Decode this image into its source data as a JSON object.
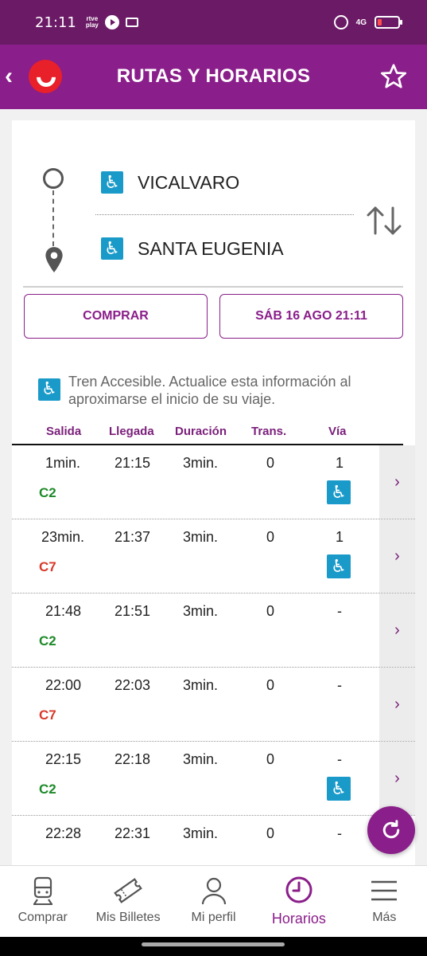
{
  "status_bar": {
    "time": "21:11",
    "rtve_label": "rtve\nplay",
    "network": "4G"
  },
  "app_bar": {
    "title": "RUTAS Y HORARIOS",
    "back_icon": "chevron-left-icon",
    "favorite_icon": "star-outline-icon"
  },
  "route": {
    "origin": "VICALVARO",
    "destination": "SANTA EUGENIA"
  },
  "actions": {
    "buy_label": "COMPRAR",
    "date_label": "SÁB 16 AGO 21:11"
  },
  "notice": "Tren Accesible. Actualice esta información al aproximarse el inicio de su viaje.",
  "table": {
    "headers": [
      "Salida",
      "Llegada",
      "Duración",
      "Trans.",
      "Vía"
    ],
    "rows": [
      {
        "salida": "1min.",
        "llegada": "21:15",
        "duracion": "3min.",
        "trans": "0",
        "via": "1",
        "line": "C2",
        "line_color": "#1e8a2a",
        "accessible": true
      },
      {
        "salida": "23min.",
        "llegada": "21:37",
        "duracion": "3min.",
        "trans": "0",
        "via": "1",
        "line": "C7",
        "line_color": "#d8392b",
        "accessible": true
      },
      {
        "salida": "21:48",
        "llegada": "21:51",
        "duracion": "3min.",
        "trans": "0",
        "via": "-",
        "line": "C2",
        "line_color": "#1e8a2a",
        "accessible": false
      },
      {
        "salida": "22:00",
        "llegada": "22:03",
        "duracion": "3min.",
        "trans": "0",
        "via": "-",
        "line": "C7",
        "line_color": "#d8392b",
        "accessible": false
      },
      {
        "salida": "22:15",
        "llegada": "22:18",
        "duracion": "3min.",
        "trans": "0",
        "via": "-",
        "line": "C2",
        "line_color": "#1e8a2a",
        "accessible": true
      },
      {
        "salida": "22:28",
        "llegada": "22:31",
        "duracion": "3min.",
        "trans": "0",
        "via": "-",
        "line": "",
        "line_color": "#1e8a2a",
        "accessible": false
      }
    ]
  },
  "bottom_nav": [
    {
      "label": "Comprar",
      "icon": "train-icon",
      "active": false
    },
    {
      "label": "Mis Billetes",
      "icon": "ticket-icon",
      "active": false
    },
    {
      "label": "Mi perfil",
      "icon": "user-icon",
      "active": false
    },
    {
      "label": "Horarios",
      "icon": "clock-icon",
      "active": true
    },
    {
      "label": "Más",
      "icon": "menu-icon",
      "active": false
    }
  ],
  "colors": {
    "brand": "#8a1e8a",
    "status_bar": "#6b1a66",
    "accessible": "#1a9ac9"
  }
}
